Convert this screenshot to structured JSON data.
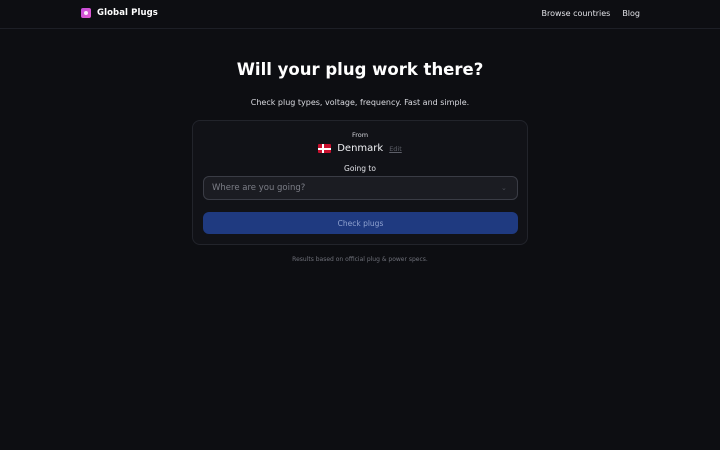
{
  "header": {
    "brand": "Global Plugs",
    "nav": [
      "Browse countries",
      "Blog"
    ]
  },
  "hero": {
    "title": "Will your plug work there?",
    "subtitle": "Check plug types, voltage, frequency. Fast and simple."
  },
  "form": {
    "from_label": "From",
    "from_country": "Denmark",
    "edit_label": "Edit",
    "going_label": "Going to",
    "destination_placeholder": "Where are you going?",
    "submit_label": "Check plugs"
  },
  "footnote": "Results based on official plug & power specs.",
  "colors": {
    "background": "#0d0e12",
    "card": "#111217",
    "button": "#1f3a80",
    "brand_logo": "#d04fd6"
  }
}
